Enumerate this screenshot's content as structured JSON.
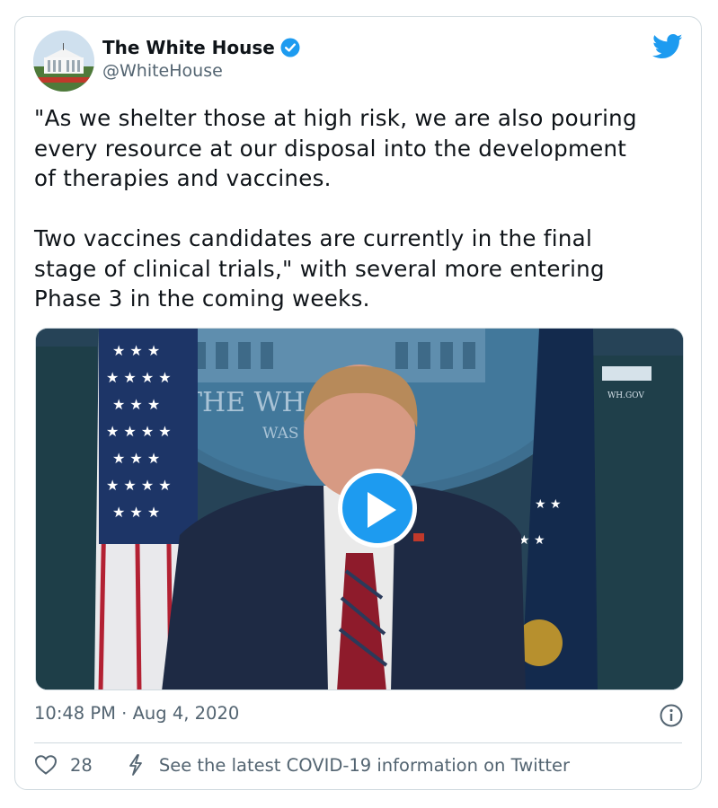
{
  "author": {
    "name": "The White House",
    "handle": "@WhiteHouse",
    "verified": true,
    "avatar_icon": "white-house-avatar"
  },
  "tweet": {
    "text": "\"As we shelter those at high risk, we are also pouring\nevery resource at our disposal into the development\nof therapies and vaccines.\n\nTwo vaccines candidates are currently in the final\nstage of clinical trials,\" with several more entering\nPhase 3 in the coming weeks.",
    "timestamp": "10:48 PM · Aug 4, 2020"
  },
  "media": {
    "type": "video",
    "backdrop_text": "THE WH     OUSE",
    "backdrop_subtext": "WAS",
    "watermark": "WH.GOV",
    "play_icon": "play-icon"
  },
  "footer": {
    "like_count": "28",
    "covid_link": "See the latest COVID-19 information on Twitter"
  },
  "colors": {
    "accent": "#1d9bf0",
    "secondary_text": "#536471",
    "border": "#cfd9de"
  }
}
